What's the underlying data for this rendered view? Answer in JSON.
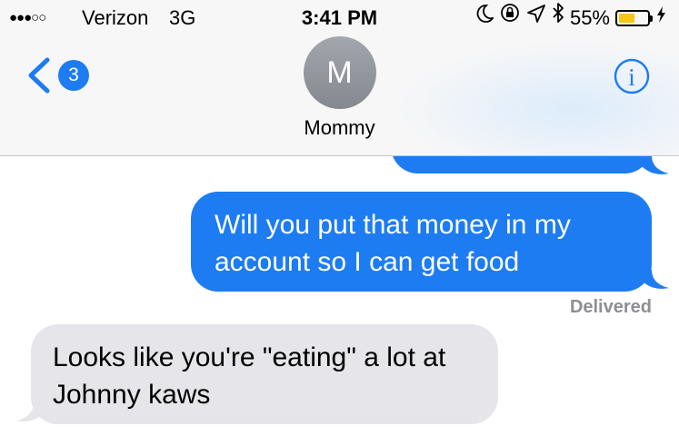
{
  "status_bar": {
    "signal": "●●●○○",
    "carrier": "Verizon",
    "network": "3G",
    "time": "3:41 PM",
    "battery_percent": "55%",
    "battery_level": 0.55,
    "icons": [
      "moon-icon",
      "rotation-lock-icon",
      "location-arrow-icon",
      "bluetooth-icon",
      "battery-icon",
      "charging-bolt-icon"
    ]
  },
  "nav": {
    "back_badge": "3",
    "contact_initial": "M",
    "contact_name": "Mommy",
    "info_label": "i"
  },
  "messages": [
    {
      "direction": "outgoing",
      "text": "Will you put that money in my account so I can get food",
      "status": "Delivered"
    },
    {
      "direction": "incoming",
      "text": "Looks like you're \"eating\" a lot at Johnny kaws"
    }
  ],
  "colors": {
    "outgoing_bubble": "#1d7cf2",
    "incoming_bubble": "#e5e5ea",
    "header_bg": "#f7f7f8",
    "battery": "#f5c518",
    "accent": "#1d7cf2"
  }
}
